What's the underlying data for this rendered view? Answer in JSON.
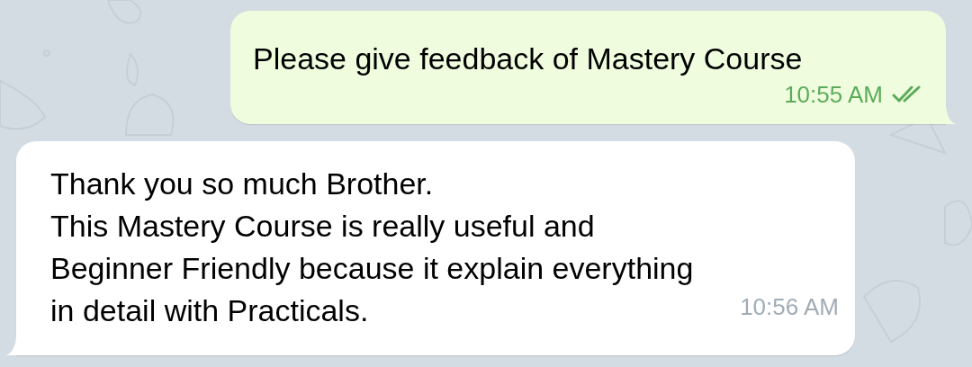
{
  "messages": [
    {
      "kind": "outgoing",
      "lines": [
        "Please give feedback of Mastery Course"
      ],
      "time": "10:55 AM",
      "read": true
    },
    {
      "kind": "incoming",
      "lines": [
        "Thank you so much Brother.",
        "This Mastery Course is really useful and",
        "Beginner Friendly because it explain everything",
        "in detail with Practicals."
      ],
      "time": "10:56 AM"
    }
  ]
}
